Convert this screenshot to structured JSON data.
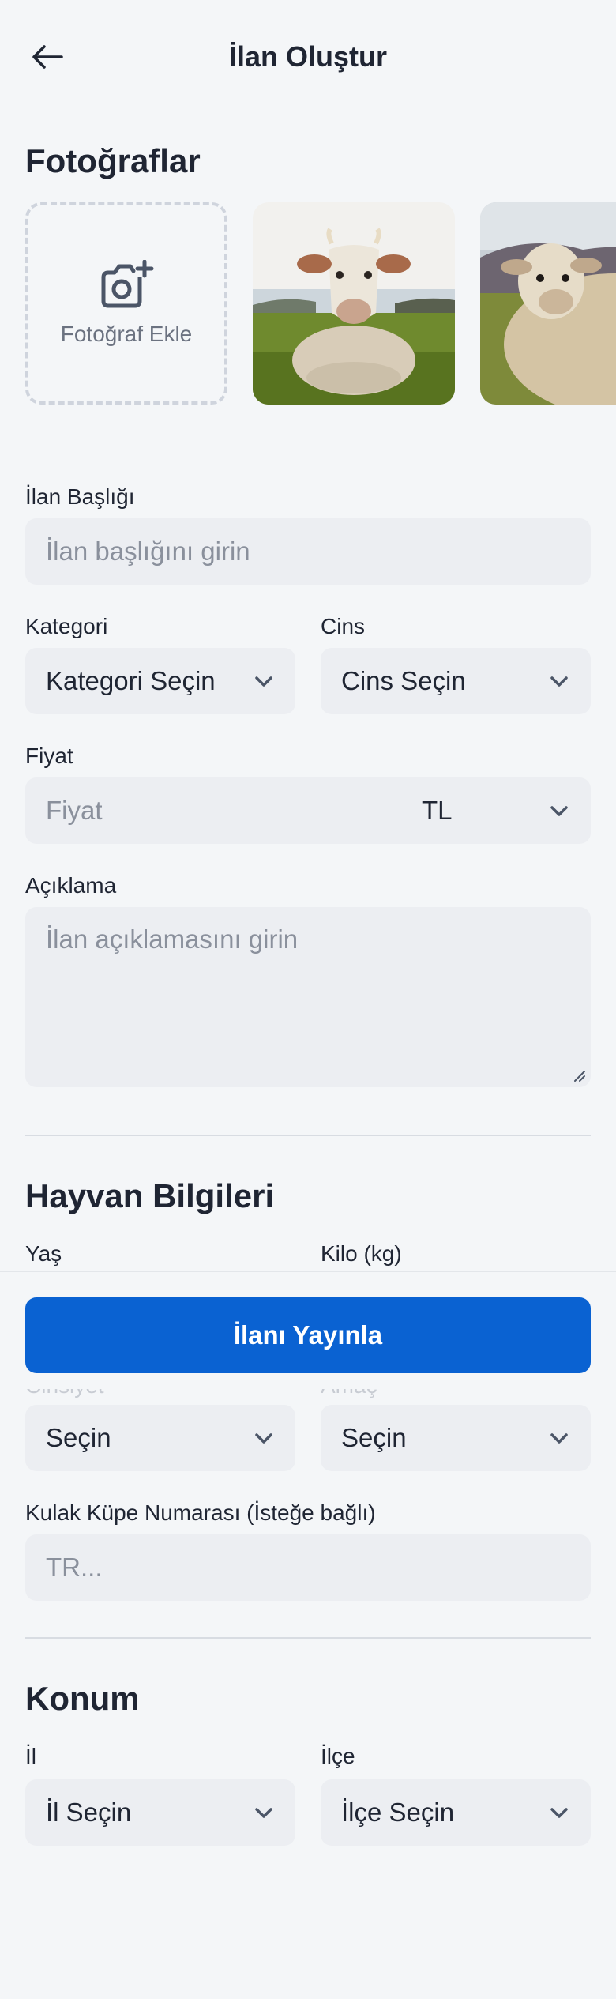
{
  "header": {
    "title": "İlan Oluştur",
    "back_icon": "arrow-left-icon"
  },
  "photos": {
    "title": "Fotoğraflar",
    "add_label": "Fotoğraf Ekle",
    "add_icon": "camera-plus-icon",
    "items": [
      {
        "name": "cow-photo"
      },
      {
        "name": "sheep-photo"
      }
    ]
  },
  "form": {
    "title_label": "İlan Başlığı",
    "title_placeholder": "İlan başlığını girin",
    "category_label": "Kategori",
    "category_value": "Kategori Seçin",
    "breed_label": "Cins",
    "breed_value": "Cins Seçin",
    "price_label": "Fiyat",
    "price_placeholder": "Fiyat",
    "currency_value": "TL",
    "description_label": "Açıklama",
    "description_placeholder": "İlan açıklamasını girin"
  },
  "animal": {
    "title": "Hayvan Bilgileri",
    "age_label": "Yaş",
    "weight_label": "Kilo (kg)",
    "hidden_left_label": "Cinsiyet",
    "hidden_right_label": "Amaç",
    "left_select": "Seçin",
    "right_select": "Seçin",
    "ear_tag_label": "Kulak Küpe Numarası (İsteğe bağlı)",
    "ear_tag_placeholder": "TR..."
  },
  "location": {
    "title": "Konum",
    "province_label": "İl",
    "province_value": "İl Seçin",
    "district_label": "İlçe",
    "district_value": "İlçe Seçin"
  },
  "actions": {
    "publish_label": "İlanı Yayınla"
  },
  "colors": {
    "primary": "#0a62d2",
    "background": "#f4f6f8",
    "field": "#eceef2"
  }
}
